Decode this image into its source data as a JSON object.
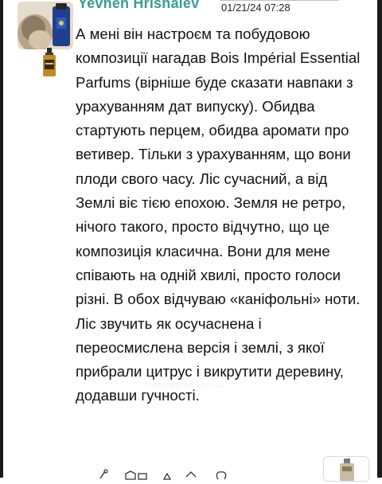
{
  "comment": {
    "author": "Yevhen Hrishaiev",
    "timestamp": "01/21/24 07:28",
    "text": "А мені він настроєм та побудовою композиції нагадав Bois Impérial Essential Parfums (вірніше буде сказати навпаки з урахуванням дат випуску). Обидва стартують перцем, обидва аромати про ветивер. Тільки з урахуванням, що вони плоди свого часу. Ліс сучасний, а від Землі віє тією епохою. Земля не ретро, нічого такого, просто відчутно, що це композиція класична. Вони для мене співають на одній хвилі, просто голоси різні. В обох відчуваю «каніфольні» ноти. Ліс звучить як осучаснена і переосмислена версія і землі, з якої прибрали цитрус і викрутити деревину, додавши гучності."
  },
  "colors": {
    "author_name": "#3a9a95",
    "text": "#111111",
    "timestamp": "#222222",
    "frame": "#1a1a1a"
  },
  "icons": {
    "avatar": "avatar-icon",
    "perfume_bottle": "perfume-bottle-icon",
    "attached_image": "attached-bottle-image",
    "footer_actions": "reaction-icons"
  }
}
